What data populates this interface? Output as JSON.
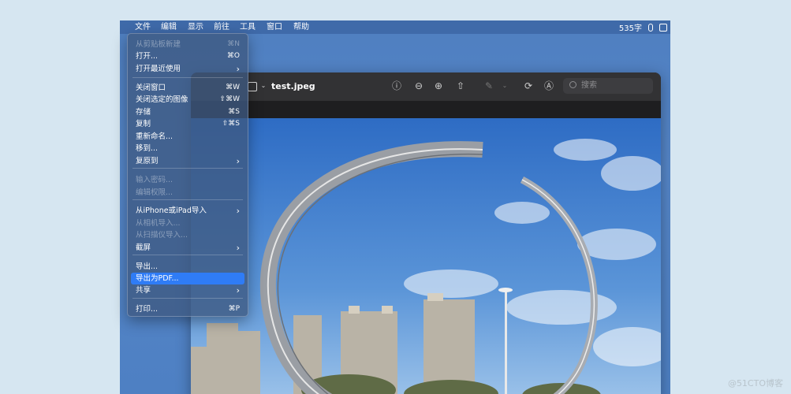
{
  "menubar": {
    "apple_partial": " ",
    "items": [
      "文件",
      "编辑",
      "显示",
      "前往",
      "工具",
      "窗口",
      "帮助"
    ],
    "word_count": "535字"
  },
  "window": {
    "title": "test.jpeg",
    "search_placeholder": "搜索"
  },
  "file_menu": {
    "items": [
      {
        "label": "从剪贴板新建",
        "shortcut": "⌘N",
        "disabled": true
      },
      {
        "label": "打开...",
        "shortcut": "⌘O"
      },
      {
        "label": "打开最近使用",
        "submenu": true
      },
      {
        "label": "关闭窗口",
        "shortcut": "⌘W"
      },
      {
        "label": "关闭选定的图像",
        "shortcut": "⇧⌘W"
      },
      {
        "label": "存储",
        "shortcut": "⌘S"
      },
      {
        "label": "复制",
        "shortcut": "⇧⌘S"
      },
      {
        "label": "重新命名..."
      },
      {
        "label": "移到..."
      },
      {
        "label": "复原到",
        "submenu": true
      },
      {
        "label": "输入密码...",
        "disabled": true
      },
      {
        "label": "编辑权限...",
        "disabled": true
      },
      {
        "label": "从iPhone或iPad导入",
        "submenu": true
      },
      {
        "label": "从相机导入...",
        "disabled": true
      },
      {
        "label": "从扫描仪导入...",
        "disabled": true
      },
      {
        "label": "截屏",
        "submenu": true
      },
      {
        "label": "导出..."
      },
      {
        "label": "导出为PDF...",
        "selected": true
      },
      {
        "label": "共享",
        "submenu": true
      },
      {
        "label": "打印...",
        "shortcut": "⌘P"
      }
    ],
    "submenu_arrow": "›"
  },
  "watermark": "@51CTO博客"
}
